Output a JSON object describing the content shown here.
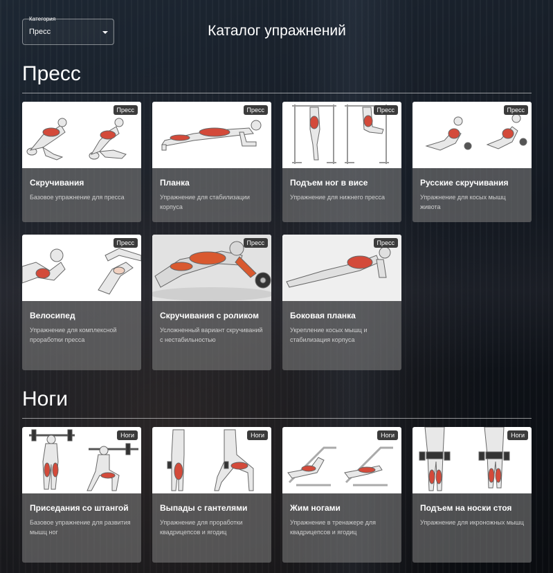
{
  "filter": {
    "label": "Категория",
    "value": "Пресс"
  },
  "page_title": "Каталог упражнений",
  "sections": [
    {
      "title": "Пресс",
      "cards": [
        {
          "title": "Скручивания",
          "desc": "Базовое упражнение для пресса",
          "badge": "Пресс"
        },
        {
          "title": "Планка",
          "desc": "Упражнение для стабилизации корпуса",
          "badge": "Пресс"
        },
        {
          "title": "Подъем ног в висе",
          "desc": "Упражнение для нижнего пресса",
          "badge": "Пресс"
        },
        {
          "title": "Русские скручивания",
          "desc": "Упражнение для косых мышц живота",
          "badge": "Пресс"
        },
        {
          "title": "Велосипед",
          "desc": "Упражнение для комплексной проработки пресса",
          "badge": "Пресс"
        },
        {
          "title": "Скручивания с роликом",
          "desc": "Усложненный вариант скручиваний с нестабильностью",
          "badge": "Пресс"
        },
        {
          "title": "Боковая планка",
          "desc": "Укрепление косых мышц и стабилизация корпуса",
          "badge": "Пресс"
        }
      ]
    },
    {
      "title": "Ноги",
      "cards": [
        {
          "title": "Приседания со штангой",
          "desc": "Базовое упражнение для развития мышц ног",
          "badge": "Ноги"
        },
        {
          "title": "Выпады с гантелями",
          "desc": "Упражнение для проработки квадрицепсов и ягодиц",
          "badge": "Ноги"
        },
        {
          "title": "Жим ногами",
          "desc": "Упражнение в тренажере для квадрицепсов и ягодиц",
          "badge": "Ноги"
        },
        {
          "title": "Подъем на носки стоя",
          "desc": "Упражнение для икроножных мышц",
          "badge": "Ноги"
        }
      ]
    }
  ]
}
